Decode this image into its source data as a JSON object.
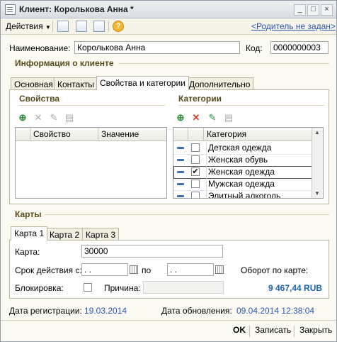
{
  "window": {
    "title": "Клиент: Королькова Анна *",
    "buttons": [
      "_",
      "□",
      "×"
    ]
  },
  "toolbar": {
    "actions_label": "Действия",
    "parent_link": "<Родитель не задан>"
  },
  "header": {
    "name_label": "Наименование:",
    "name_value": "Королькова Анна",
    "code_label": "Код:",
    "code_value": "0000000003"
  },
  "client_info": {
    "title": "Информация о клиенте",
    "tabs": [
      {
        "label": "Основная"
      },
      {
        "label": "Контакты"
      },
      {
        "label": "Свойства и категории"
      },
      {
        "label": "Дополнительно"
      }
    ]
  },
  "properties": {
    "title": "Свойства",
    "col_property": "Свойство",
    "col_value": "Значение"
  },
  "categories": {
    "title": "Категории",
    "col_category": "Категория",
    "rows": [
      {
        "label": "Детская одежда",
        "checked": false
      },
      {
        "label": "Женская обувь",
        "checked": false
      },
      {
        "label": "Женская одежда",
        "checked": true
      },
      {
        "label": "Мужская одежда",
        "checked": false
      },
      {
        "label": "Элитный алкоголь",
        "checked": false
      }
    ]
  },
  "cards": {
    "title": "Карты",
    "tabs": [
      {
        "label": "Карта 1"
      },
      {
        "label": "Карта 2"
      },
      {
        "label": "Карта 3"
      }
    ],
    "card_label": "Карта:",
    "card_value": "30000",
    "valid_from_label": "Срок действия с:",
    "date_placeholder": " .  .",
    "to_label": "по",
    "turnover_label": "Оборот по карте:",
    "turnover_value": "9 467,44 RUB",
    "block_label": "Блокировка:",
    "reason_label": "Причина:"
  },
  "meta": {
    "reg_label": "Дата регистрации:",
    "reg_value": "19.03.2014",
    "upd_label": "Дата обновления:",
    "upd_value": "09.04.2014 12:38:04"
  },
  "footer": {
    "ok": "OK",
    "save": "Записать",
    "close": "Закрыть"
  },
  "colors": {
    "accent": "#1a5fb4",
    "section": "#5a4a1c",
    "link": "#2b56b8"
  }
}
